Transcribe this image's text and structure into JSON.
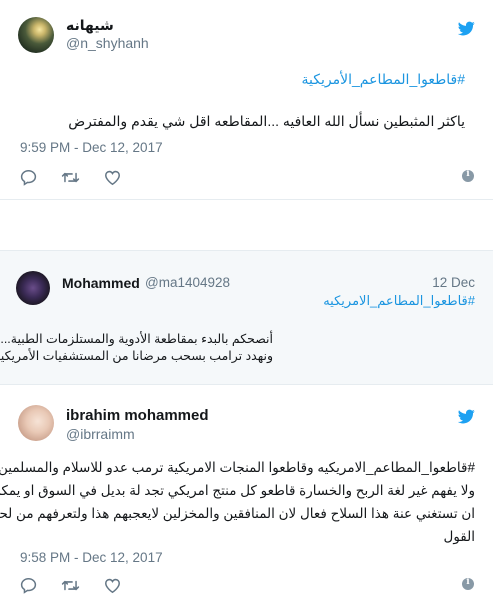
{
  "tweet1": {
    "display_name": "شيهانه",
    "handle": "@n_shyhanh",
    "hashtag": "#قاطعوا_المطاعم_الأمريكية",
    "text": "ياكثر المثبطين نسأل الله العافيه ...المقاطعه اقل شي يقدم والمفترض",
    "timestamp": "9:59 PM - Dec 12, 2017"
  },
  "tweet2": {
    "display_name": "Mohammed",
    "handle": "@ma1404928",
    "date": "12 Dec",
    "hashtag": "#قاطعوا_المطاعم_الامريكيه",
    "line1": "أنصحكم بالبدء بمقاطعة الأدوية والمستلزمات الطبية...",
    "line2": "ونهدد ترامب بسحب مرضانا من المستشفيات الأمريكية."
  },
  "tweet3": {
    "display_name": "ibrahim mohammed",
    "handle": "@ibrraimm",
    "line1": "#قاطعوا_المطاعم_الامريكيه وقاطعوا المنجات الامريكية ترمب عدو للاسلام والمسلمين",
    "line2": "ولا يفهم غير لغة الربح والخسارة قاطعو كل منتج امريكي تجد لة بديل في السوق او يمكن",
    "line3": "ان تستغني عنة هذا السلاح فعال لان المنافقين والمخزلين لايعجبهم هذا ولتعرفهم من لحن",
    "line4": "القول",
    "timestamp": "9:58 PM - Dec 12, 2017"
  },
  "colors": {
    "link": "#1b95e0",
    "bird": "#1da1f2",
    "meta": "#657786",
    "heart": "#657786"
  },
  "icons": [
    "twitter-bird-icon",
    "reply-icon",
    "retweet-icon",
    "like-icon",
    "info-icon"
  ]
}
